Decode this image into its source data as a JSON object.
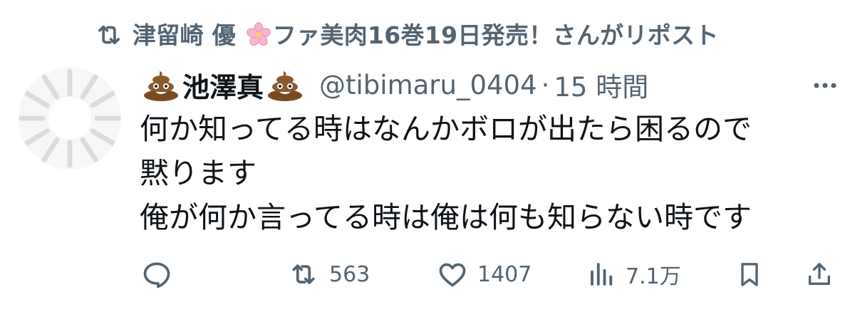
{
  "repost": {
    "icon": "repost-icon",
    "reposter_name_before": "津留崎 優",
    "reposter_emoji": "cherry-blossom-emoji",
    "reposter_name_after": "ファ美肉16巻19日発売！",
    "suffix": "さんがリポスト"
  },
  "author": {
    "emoji_left": "poop-emoji",
    "display_name": "池澤真",
    "emoji_right": "poop-emoji",
    "handle": "@tibimaru_0404",
    "separator": "·",
    "time": "15 時間"
  },
  "tweet": {
    "lines": [
      "何か知ってる時はなんかボロが出たら困るので",
      "黙ります",
      "俺が何か言ってる時は俺は何も知らない時です"
    ]
  },
  "actions": {
    "reply": {
      "icon": "reply-icon",
      "count": ""
    },
    "repost": {
      "icon": "repost-icon",
      "count": "563"
    },
    "like": {
      "icon": "heart-icon",
      "count": "1407"
    },
    "views": {
      "icon": "views-icon",
      "count": "7.1万"
    },
    "bookmark": {
      "icon": "bookmark-icon"
    },
    "share": {
      "icon": "share-icon"
    }
  },
  "colors": {
    "text_primary": "#0f1419",
    "text_secondary": "#536471",
    "background": "#ffffff"
  }
}
